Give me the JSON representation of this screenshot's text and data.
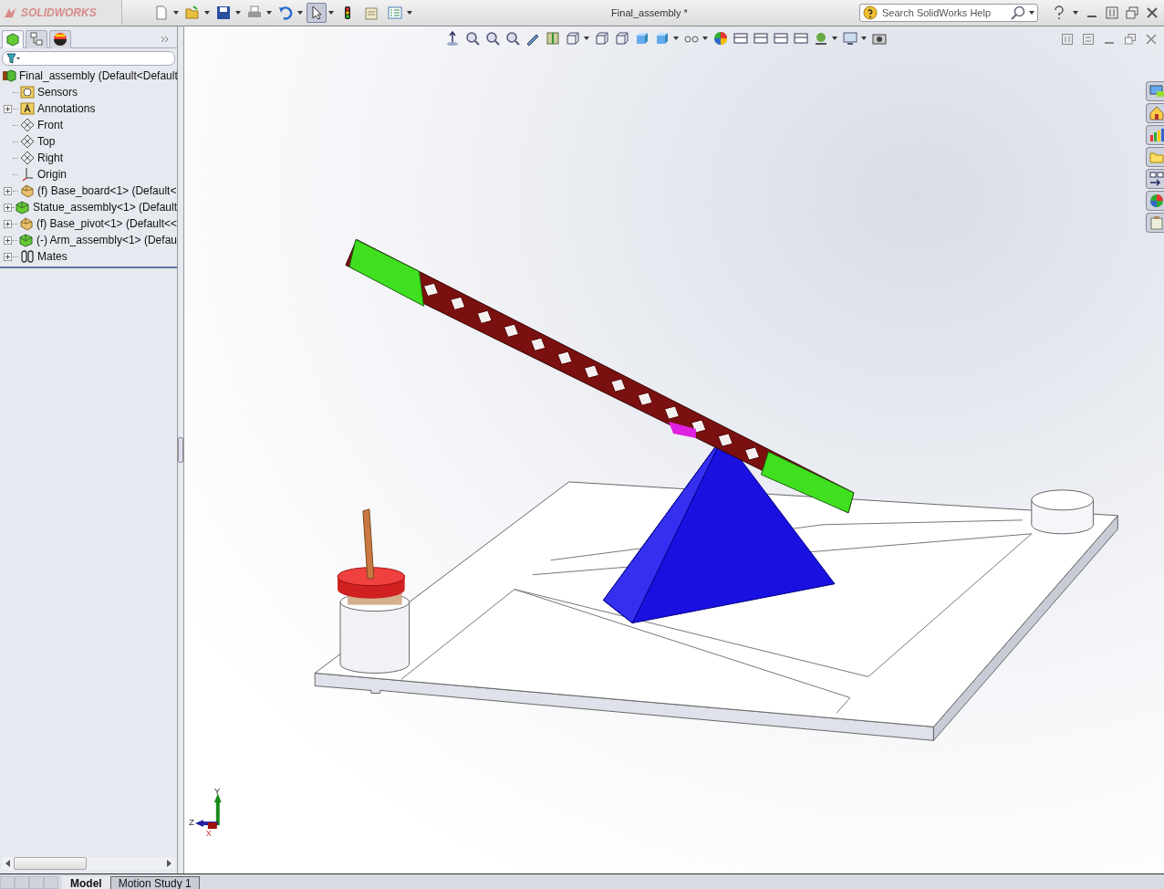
{
  "app": {
    "logo": "SOLIDWORKS",
    "title": "Final_assembly *"
  },
  "search": {
    "placeholder": "Search SolidWorks Help"
  },
  "toolbar": [
    {
      "kind": "new",
      "menu": true,
      "selected": false
    },
    {
      "kind": "open",
      "menu": true,
      "selected": false
    },
    {
      "kind": "save",
      "menu": true,
      "selected": false
    },
    {
      "kind": "print",
      "menu": true,
      "selected": false
    },
    {
      "kind": "undo",
      "menu": true,
      "selected": false
    },
    {
      "kind": "select",
      "menu": true,
      "selected": true
    },
    {
      "kind": "rebuild",
      "menu": false,
      "selected": false
    },
    {
      "kind": "properties",
      "menu": false,
      "selected": false
    },
    {
      "kind": "options",
      "menu": true,
      "selected": false
    }
  ],
  "panel_tabs": [
    {
      "kind": "feature",
      "selected": true
    },
    {
      "kind": "property",
      "selected": false
    },
    {
      "kind": "appearance",
      "selected": false
    }
  ],
  "tree": {
    "root": {
      "kind": "assembly",
      "label": "Final_assembly  (Default<Default"
    },
    "children": [
      {
        "kind": "sensor",
        "label": "Sensors",
        "expandable": false
      },
      {
        "kind": "annotation",
        "label": "Annotations",
        "expandable": true
      },
      {
        "kind": "plane",
        "label": "Front",
        "expandable": false
      },
      {
        "kind": "plane",
        "label": "Top",
        "expandable": false
      },
      {
        "kind": "plane",
        "label": "Right",
        "expandable": false
      },
      {
        "kind": "origin",
        "label": "Origin",
        "expandable": false
      },
      {
        "kind": "part",
        "label": "(f) Base_board<1> (Default<",
        "expandable": true
      },
      {
        "kind": "assembly",
        "label": "Statue_assembly<1> (Default",
        "expandable": true
      },
      {
        "kind": "part",
        "label": "(f) Base_pivot<1> (Default<<",
        "expandable": true
      },
      {
        "kind": "assembly",
        "label": "(-) Arm_assembly<1> (Defau",
        "expandable": true
      },
      {
        "kind": "mates",
        "label": "Mates",
        "expandable": true
      }
    ]
  },
  "triad": {
    "x": "X",
    "y": "Y",
    "z": "Z"
  },
  "bottom_tabs": [
    {
      "label": "Model",
      "selected": true
    },
    {
      "label": "Motion Study 1",
      "selected": false
    }
  ]
}
